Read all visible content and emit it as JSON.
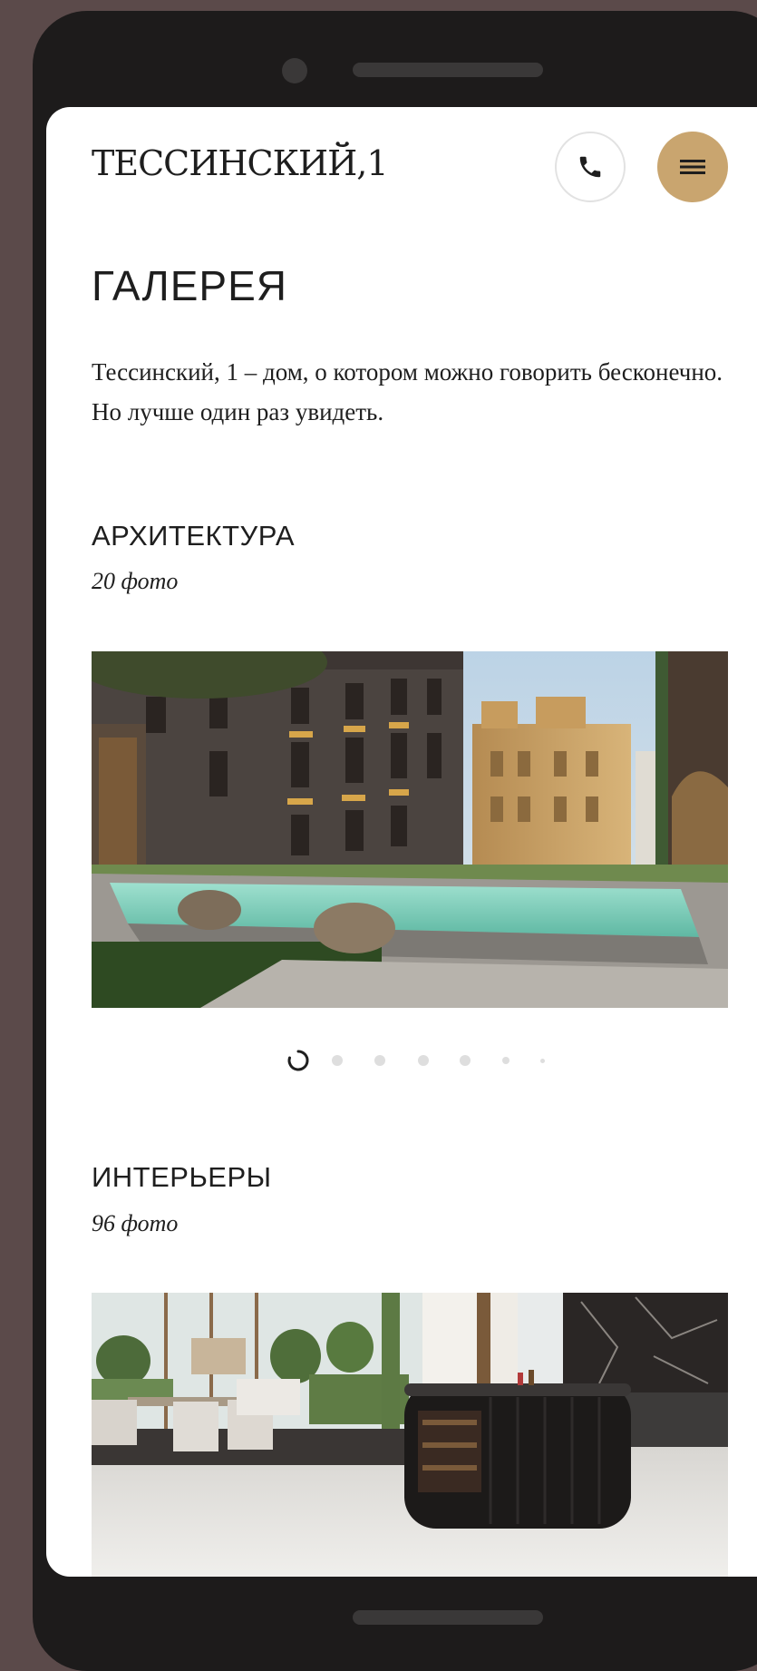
{
  "header": {
    "logo": "ТЕССИНСКИЙ,1",
    "phone_icon": "phone-icon",
    "menu_icon": "menu-icon"
  },
  "page": {
    "title": "ГАЛЕРЕЯ",
    "intro": "Тессинский, 1 – дом, о котором можно говорить бесконечно. Но лучше один раз увидеть."
  },
  "sections": [
    {
      "title": "АРХИТЕКТУРА",
      "count": "20 фото"
    },
    {
      "title": "ИНТЕРЬЕРЫ",
      "count": "96 фото"
    }
  ],
  "carousel": {
    "total_slides": 7,
    "active_slide": 1
  },
  "colors": {
    "accent": "#c9a56f",
    "text": "#1e1e1e",
    "frame": "#1d1b1b",
    "background": "#5b4a4a"
  }
}
